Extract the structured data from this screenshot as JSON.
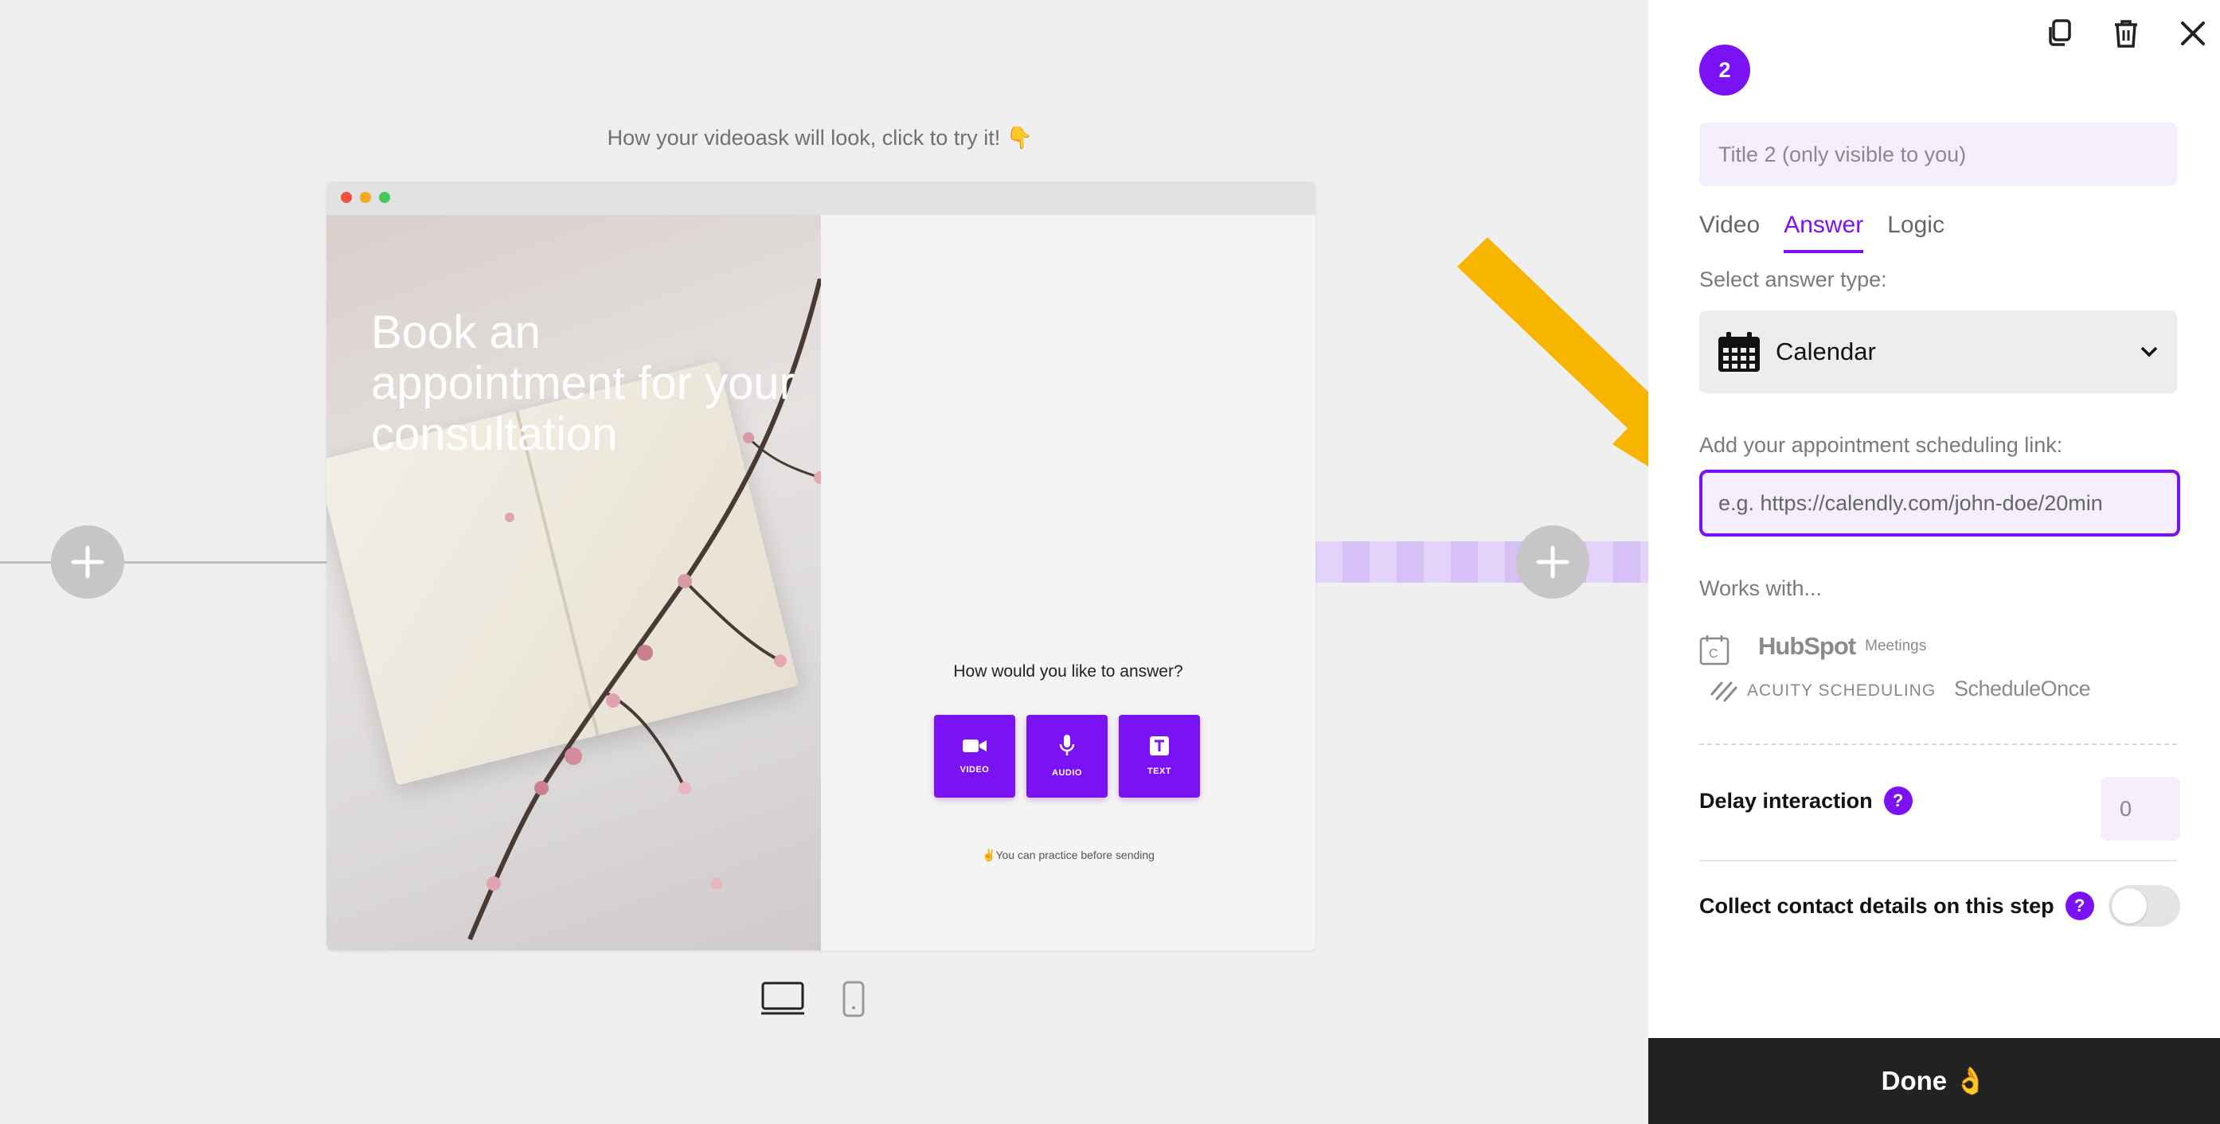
{
  "canvas": {
    "caption": "How your videoask will look, click to try it! 👇",
    "headline": "Book an appointment for your consultation",
    "question": "How would you like to answer?",
    "answer_buttons": [
      {
        "label": "VIDEO",
        "icon": "video-camera-icon"
      },
      {
        "label": "AUDIO",
        "icon": "microphone-icon"
      },
      {
        "label": "TEXT",
        "icon": "text-icon"
      }
    ],
    "practice_note": "✌️You can practice before sending",
    "devices": [
      "desktop-icon",
      "mobile-icon"
    ]
  },
  "panel": {
    "header_icons": [
      "duplicate-icon",
      "trash-icon",
      "close-icon"
    ],
    "step_number": "2",
    "title_placeholder": "Title 2 (only visible to you)",
    "tabs": [
      {
        "label": "Video",
        "active": false
      },
      {
        "label": "Answer",
        "active": true
      },
      {
        "label": "Logic",
        "active": false
      }
    ],
    "answer_type_label": "Select answer type:",
    "answer_type_value": "Calendar",
    "link_label": "Add your appointment scheduling link:",
    "link_placeholder": "e.g. https://calendly.com/john-doe/20min",
    "works_with_label": "Works with...",
    "integrations": {
      "calendly": "C",
      "hubspot": "HubSpot",
      "hubspot_sub": "Meetings",
      "acuity": "ACUITY SCHEDULING",
      "scheduleonce": "ScheduleOnce"
    },
    "delay_label": "Delay interaction",
    "delay_value": "0",
    "collect_label": "Collect contact details on this step",
    "collect_enabled": false,
    "done_label": "Done 👌"
  },
  "colors": {
    "accent": "#7b12f4",
    "arrow": "#f7b500",
    "done_bg": "#222222"
  }
}
